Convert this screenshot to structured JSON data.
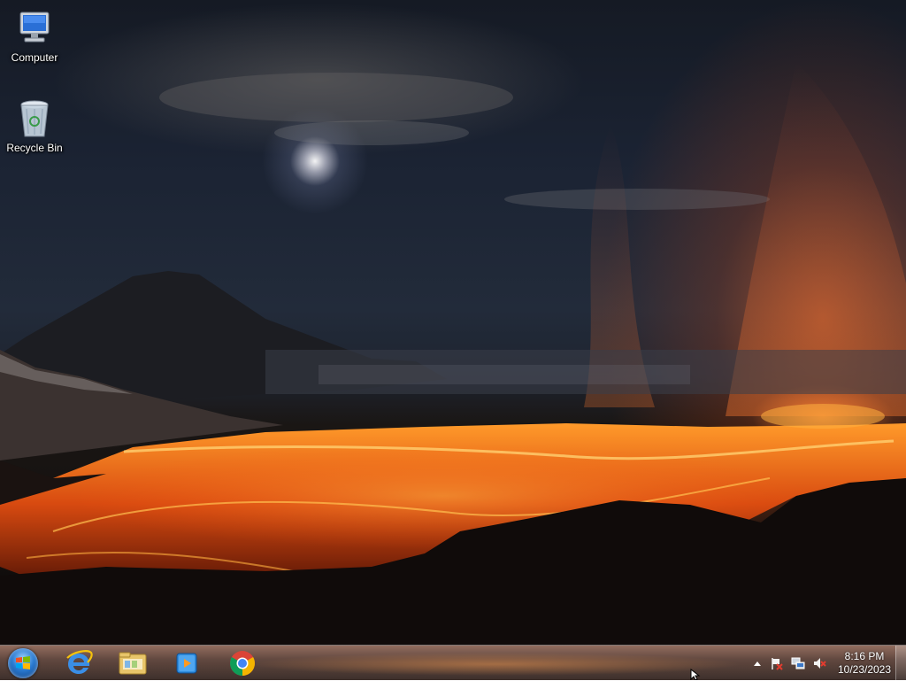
{
  "desktop": {
    "wallpaper": "lava-volcano-night",
    "icons": [
      {
        "label": "Computer",
        "icon": "computer-icon"
      },
      {
        "label": "Recycle Bin",
        "icon": "recycle-bin-icon"
      }
    ]
  },
  "taskbar": {
    "start_button": "windows-start-orb",
    "pinned": [
      {
        "name": "Internet Explorer",
        "icon": "internet-explorer-icon"
      },
      {
        "name": "Windows Explorer",
        "icon": "file-explorer-icon"
      },
      {
        "name": "Windows Media Player",
        "icon": "media-player-icon"
      },
      {
        "name": "Google Chrome",
        "icon": "chrome-icon"
      }
    ],
    "tray": {
      "icons": [
        "show-hidden-icons-arrow",
        "action-center-flag-icon",
        "network-icon",
        "volume-muted-icon"
      ],
      "time": "8:16 PM",
      "date": "10/23/2023"
    }
  },
  "colors": {
    "lava": "#ff7a1a",
    "sky": "#1b2333",
    "taskbar": "#5a3326"
  }
}
